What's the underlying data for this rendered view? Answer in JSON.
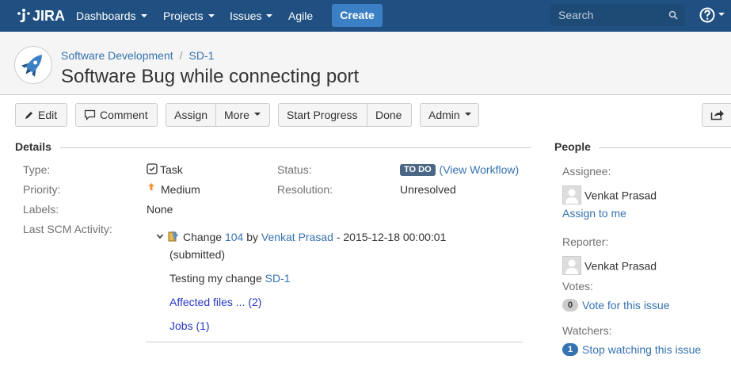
{
  "nav": {
    "logo": "JIRA",
    "dashboards": "Dashboards",
    "projects": "Projects",
    "issues": "Issues",
    "agile": "Agile",
    "create": "Create",
    "search_placeholder": "Search",
    "help_icon": "help-icon"
  },
  "header": {
    "project": "Software Development",
    "separator": "/",
    "issue_key": "SD-1",
    "title": "Software Bug while connecting port"
  },
  "toolbar": {
    "edit": "Edit",
    "comment": "Comment",
    "assign": "Assign",
    "more": "More",
    "start_progress": "Start Progress",
    "done": "Done",
    "admin": "Admin"
  },
  "details": {
    "heading": "Details",
    "type_label": "Type:",
    "type_value": "Task",
    "priority_label": "Priority:",
    "priority_value": "Medium",
    "labels_label": "Labels:",
    "labels_value": "None",
    "scm_label": "Last SCM Activity:",
    "status_label": "Status:",
    "status_value": "TO DO",
    "view_workflow": "(View Workflow)",
    "resolution_label": "Resolution:",
    "resolution_value": "Unresolved"
  },
  "scm": {
    "change_word": "Change",
    "change_number": "104",
    "by_word": "by",
    "author": "Venkat Prasad",
    "datetime": "- 2015-12-18 00:00:01",
    "state": "(submitted)",
    "message_prefix": "Testing my change",
    "message_link": "SD-1",
    "affected_files": "Affected files ... (2)",
    "jobs": "Jobs (1)"
  },
  "people": {
    "heading": "People",
    "assignee_label": "Assignee:",
    "assignee": "Venkat Prasad",
    "assign_to_me": "Assign to me",
    "reporter_label": "Reporter:",
    "reporter": "Venkat Prasad",
    "votes_label": "Votes:",
    "votes_count": "0",
    "vote_link": "Vote for this issue",
    "watchers_label": "Watchers:",
    "watchers_count": "1",
    "watch_link": "Stop watching this issue"
  },
  "colors": {
    "nav_bg": "#205081",
    "create_bg": "#3b7fc4",
    "link": "#3572b0",
    "status_lozenge": "#4a6785"
  }
}
